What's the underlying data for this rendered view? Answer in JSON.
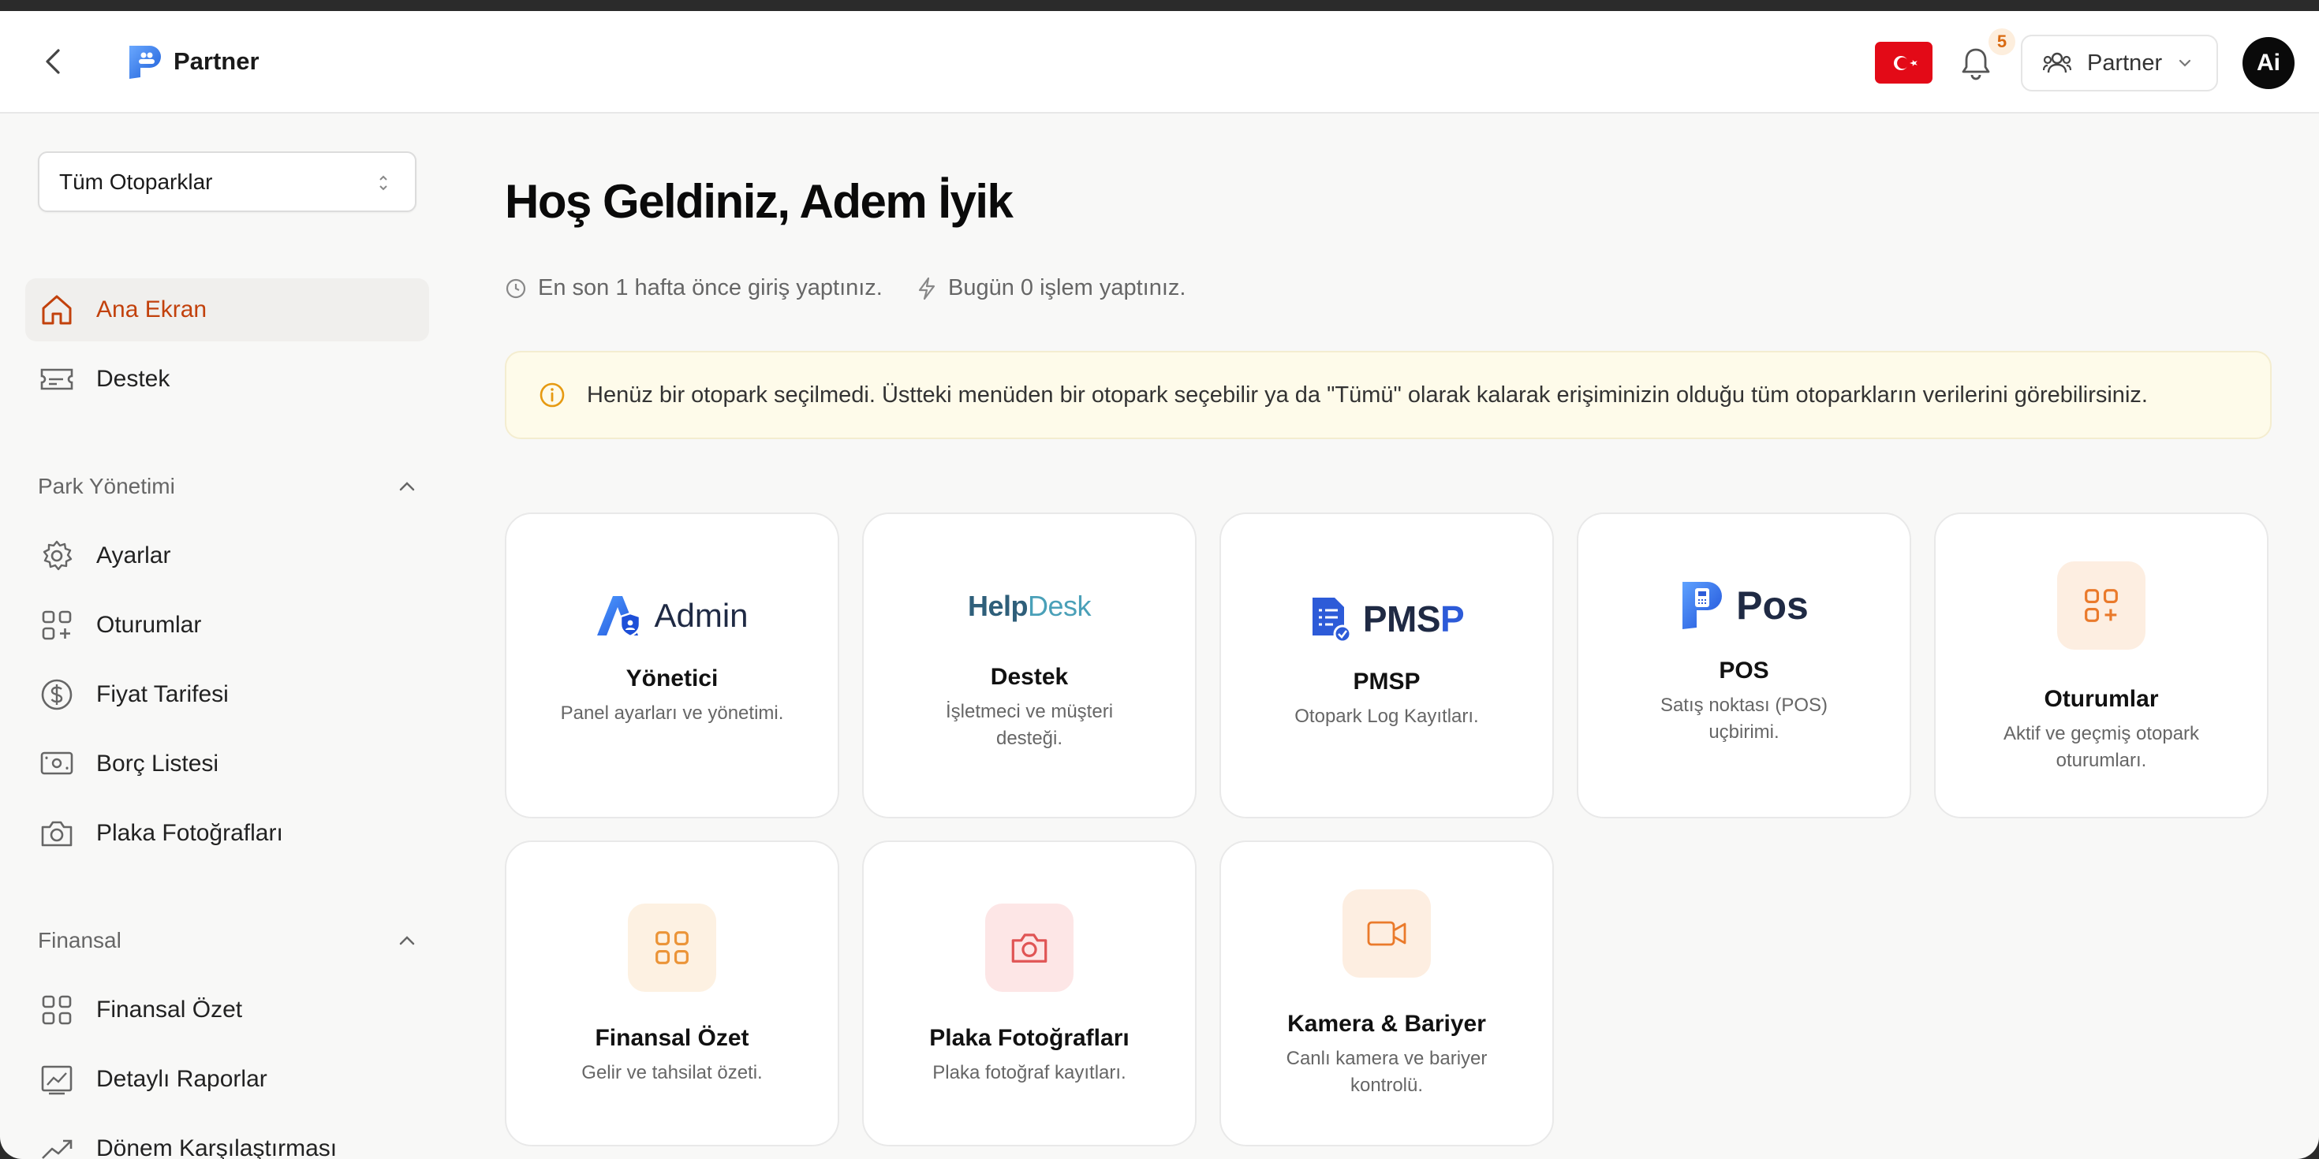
{
  "header": {
    "brand": "Partner",
    "notifications_count": "5",
    "role_label": "Partner",
    "avatar_initials": "Ai"
  },
  "sidebar": {
    "parking_select": "Tüm Otoparklar",
    "top_items": [
      {
        "label": "Ana Ekran",
        "icon": "home-icon"
      },
      {
        "label": "Destek",
        "icon": "ticket-icon"
      }
    ],
    "sections": [
      {
        "title": "Park Yönetimi",
        "items": [
          {
            "label": "Ayarlar",
            "icon": "gear-icon"
          },
          {
            "label": "Oturumlar",
            "icon": "grid-plus-icon"
          },
          {
            "label": "Fiyat Tarifesi",
            "icon": "dollar-circle-icon"
          },
          {
            "label": "Borç Listesi",
            "icon": "banknote-icon"
          },
          {
            "label": "Plaka Fotoğrafları",
            "icon": "camera-icon"
          }
        ]
      },
      {
        "title": "Finansal",
        "items": [
          {
            "label": "Finansal Özet",
            "icon": "grid-icon"
          },
          {
            "label": "Detaylı Raporlar",
            "icon": "chart-icon"
          },
          {
            "label": "Dönem Karşılaştırması",
            "icon": "trend-up-icon"
          }
        ]
      }
    ]
  },
  "main": {
    "welcome_title": "Hoş Geldiniz, Adem İyik",
    "last_login": "En son 1 hafta önce giriş yaptınız.",
    "today_ops": "Bugün 0 işlem yaptınız.",
    "alert_text": "Henüz bir otopark seçilmedi. Üstteki menüden bir otopark seçebilir ya da \"Tümü\" olarak kalarak erişiminizin olduğu tüm otoparkların verilerini görebilirsiniz.",
    "cards": [
      {
        "logo_text": "Admin",
        "title": "Yönetici",
        "desc": "Panel ayarları ve yönetimi."
      },
      {
        "logo_text": "HelpDesk",
        "logo_text_a": "Help",
        "logo_text_b": "Desk",
        "title": "Destek",
        "desc": "İşletmeci ve müşteri desteği."
      },
      {
        "logo_text": "PMSP",
        "logo_text_a": "PMS",
        "logo_text_b": "P",
        "title": "PMSP",
        "desc": "Otopark Log Kayıtları."
      },
      {
        "logo_text": "Pos",
        "title": "POS",
        "desc": "Satış noktası (POS) uçbirimi."
      },
      {
        "title": "Oturumlar",
        "desc": "Aktif ve geçmiş otopark oturumları.",
        "icon": "grid-plus-icon"
      },
      {
        "title": "Finansal Özet",
        "desc": "Gelir ve tahsilat özeti.",
        "icon": "grid-icon"
      },
      {
        "title": "Plaka Fotoğrafları",
        "desc": "Plaka fotoğraf kayıtları.",
        "icon": "camera-icon"
      },
      {
        "title": "Kamera & Bariyer",
        "desc": "Canlı kamera ve bariyer kontrolü.",
        "icon": "video-camera-icon"
      }
    ]
  },
  "colors": {
    "accent": "#c2410c",
    "orange_icon": "#ea7a2b",
    "red_icon": "#e05555",
    "alert_bg": "#fefbea",
    "flag_red": "#e30a17"
  }
}
